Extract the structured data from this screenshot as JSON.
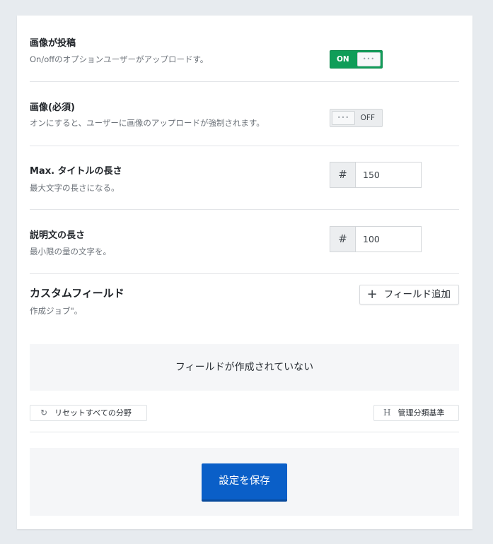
{
  "settings": [
    {
      "title": "画像が投稿",
      "desc": "On/offのオプションユーザーがアップロードす。",
      "toggle_label": "ON",
      "knob": "•••"
    },
    {
      "title": "画像(必須)",
      "desc": "オンにすると、ユーザーに画像のアップロードが強制されます。",
      "toggle_label": "OFF",
      "knob": "•••"
    },
    {
      "title": "Max. タイトルの長さ",
      "desc": "最大文字の長さになる。",
      "hash": "#",
      "value": "150"
    },
    {
      "title": "説明文の長さ",
      "desc": "最小限の量の文字を。",
      "hash": "#",
      "value": "100"
    }
  ],
  "custom_fields": {
    "title": "カスタムフィールド",
    "desc": "作成ジョブ\"。",
    "add_icon": "plus-icon",
    "add_label": "フィールド追加",
    "empty_text": "フィールドが作成されていない",
    "reset_icon": "refresh-icon",
    "reset_label": "リセットすべての分野",
    "taxonomy_icon": "heading-icon",
    "taxonomy_label": "管理分類基準"
  },
  "save": {
    "label": "設定を保存"
  },
  "colors": {
    "toggle_on": "#0f9d58",
    "primary": "#0a5fc8",
    "background": "#e7ebef"
  }
}
